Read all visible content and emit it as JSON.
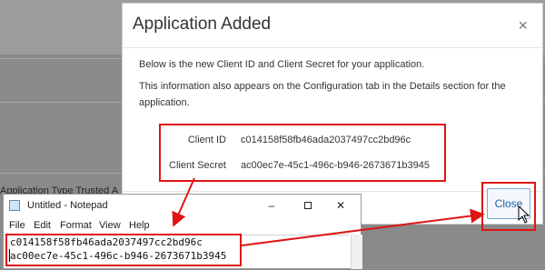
{
  "background": {
    "partial_text": "Application Type  Trusted A"
  },
  "dialog": {
    "title": "Application Added",
    "intro": "Below is the new Client ID and Client Secret for your application.",
    "info": "This information also appears on the Configuration tab in the Details section for the application.",
    "client_id_label": "Client ID",
    "client_id_value": "c014158f58fb46ada2037497cc2bd96c",
    "client_secret_label": "Client Secret",
    "client_secret_value": "ac00ec7e-45c1-496c-b946-2673671b3945",
    "close_label": "Close"
  },
  "notepad": {
    "title": "Untitled - Notepad",
    "menu": [
      "File",
      "Edit",
      "Format",
      "View",
      "Help"
    ],
    "lines": [
      "c014158f58fb46ada2037497cc2bd96c",
      "ac00ec7e-45c1-496c-b946-2673671b3945"
    ]
  },
  "colors": {
    "highlight": "#e01414",
    "close_button_text": "#1a5fa8"
  },
  "icons": [
    "close-icon",
    "notepad-icon",
    "minimize-icon",
    "maximize-icon",
    "mouse-cursor-icon"
  ]
}
